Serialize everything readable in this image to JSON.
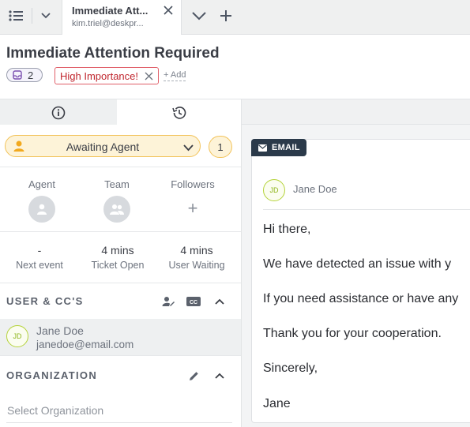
{
  "tabbar": {
    "tab_title": "Immediate Att...",
    "tab_subtitle": "kim.triel@deskpr..."
  },
  "ticket": {
    "title": "Immediate Attention Required",
    "count": "2",
    "labels": [
      "High Importance!"
    ],
    "add_label": "+ Add"
  },
  "status": {
    "label": "Awaiting Agent",
    "count": "1",
    "color": "#f2c35a"
  },
  "assignment": {
    "agent_label": "Agent",
    "team_label": "Team",
    "followers_label": "Followers",
    "followers_add": "+"
  },
  "stats": [
    {
      "value": "-",
      "label": "Next event"
    },
    {
      "value": "4 mins",
      "label": "Ticket Open"
    },
    {
      "value": "4 mins",
      "label": "User Waiting"
    }
  ],
  "users_section": {
    "title": "USER & CC'S",
    "user": {
      "initials": "JD",
      "name": "Jane Doe",
      "email": "janedoe@email.com"
    }
  },
  "org_section": {
    "title": "ORGANIZATION",
    "placeholder": "Select Organization"
  },
  "email": {
    "badge": "EMAIL",
    "sender_initials": "JD",
    "sender_name": "Jane Doe",
    "lines": [
      "Hi there,",
      "We have detected an issue with y",
      "If you need assistance or have any",
      "Thank you for your cooperation.",
      "Sincerely,",
      "Jane"
    ]
  },
  "colors": {
    "accent_dark": "#2b3a4a",
    "importance": "#c0262e",
    "avatar_ring": "#b5d33a"
  }
}
